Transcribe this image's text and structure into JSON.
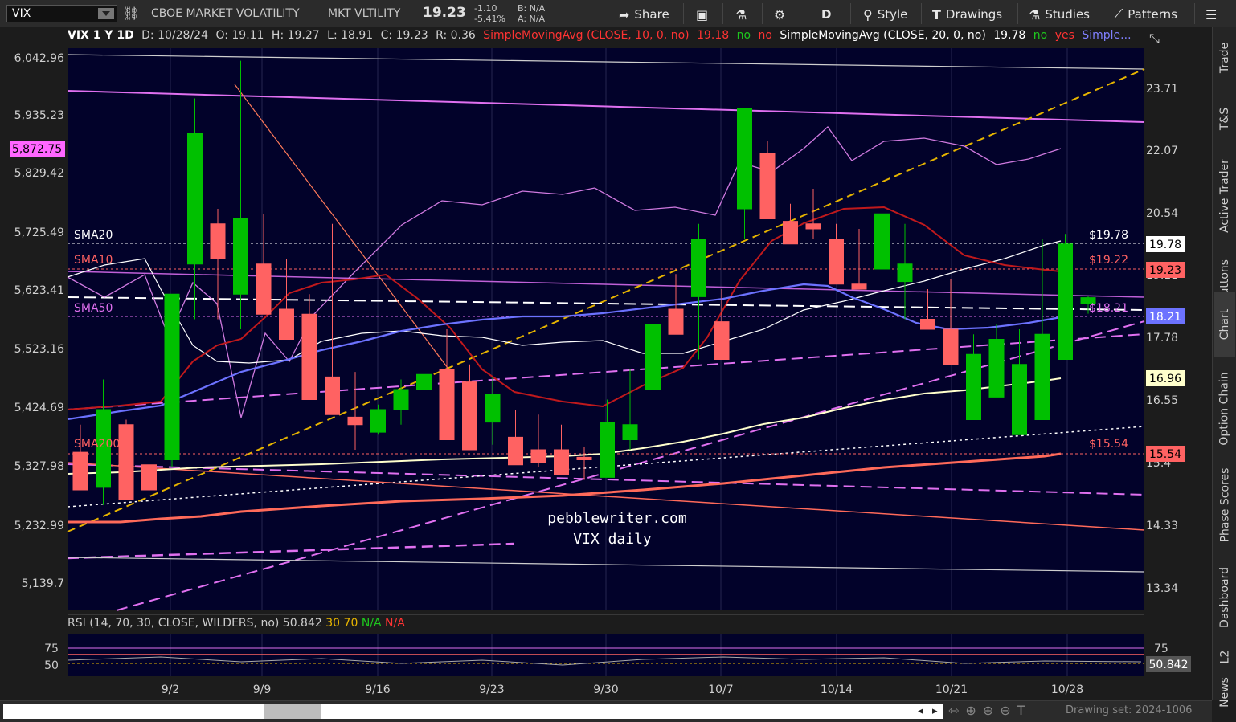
{
  "toolbar": {
    "symbol": "VIX",
    "description": "CBOE MARKET VOLATILITY",
    "short_name": "MKT VLTILITY",
    "last": "19.23",
    "change": "-1.10",
    "change_pct": "-5.41%",
    "bid": "B: N/A",
    "ask": "A: N/A",
    "share": "Share",
    "period": "D",
    "style": "Style",
    "drawings": "Drawings",
    "studies": "Studies",
    "patterns": "Patterns"
  },
  "legend": {
    "title": "VIX 1 Y 1D",
    "date": "D: 10/28/24",
    "open": "O: 19.11",
    "high": "H: 19.27",
    "low": "L: 18.91",
    "close": "C: 19.23",
    "range": "R: 0.36",
    "sma10_label": "SimpleMovingAvg (CLOSE, 10, 0, no)",
    "sma10_value": "19.18",
    "sma10_flag1": "no",
    "sma10_flag2": "no",
    "sma20_label": "SimpleMovingAvg (CLOSE, 20, 0, no)",
    "sma20_value": "19.78",
    "sma20_flag1": "no",
    "sma20_flag2": "yes",
    "more": "Simple..."
  },
  "colors": {
    "chart_bg": "#02022a",
    "up": "#00c000",
    "down": "#ff6262",
    "sma10": "#c0191c",
    "sma20": "#ffffff",
    "sma50": "#6c72ff",
    "sma200": "#ffffcc",
    "spx_line": "#d07ae0",
    "trend_yellow": "#e6b400",
    "magenta": "#e070f0"
  },
  "left_axis": [
    "6,042.96",
    "5,935.23",
    "5,829.42",
    "5,725.49",
    "5,623.41",
    "5,523.16",
    "5,424.69",
    "5,327.98",
    "5,232.99",
    "5,139.7"
  ],
  "left_marker": "5,872.75",
  "right_axis": [
    "23.71",
    "22.07",
    "20.54",
    "19.11",
    "17.78",
    "16.55",
    "15.4",
    "14.33",
    "13.34"
  ],
  "right_markers": {
    "sma20": "19.78",
    "last": "19.23",
    "sma50": "18.21",
    "sma200": "16.96",
    "support": "15.54"
  },
  "line_labels": {
    "sma20": "SMA20",
    "sma10": "SMA10",
    "sma50": "SMA50",
    "sma200": "SMA200",
    "sma20_val": "$19.78",
    "sma10_val": "$19.22",
    "sma50_val": "$18.21",
    "support_val": "$15.54"
  },
  "watermark": [
    "pebblewriter.com",
    "VIX daily"
  ],
  "x_dates": [
    "9/2",
    "9/9",
    "9/16",
    "9/23",
    "9/30",
    "10/7",
    "10/14",
    "10/21",
    "10/28"
  ],
  "chart_data": {
    "type": "candlestick",
    "symbol": "VIX",
    "timeframe": "1D",
    "yrange": [
      13.0,
      24.2
    ],
    "x": [
      "8/26",
      "8/27",
      "8/28",
      "8/29",
      "8/30",
      "9/3",
      "9/4",
      "9/5",
      "9/6",
      "9/9",
      "9/10",
      "9/11",
      "9/12",
      "9/13",
      "9/16",
      "9/17",
      "9/18",
      "9/19",
      "9/20",
      "9/23",
      "9/24",
      "9/25",
      "9/26",
      "9/27",
      "9/30",
      "10/1",
      "10/2",
      "10/3",
      "10/4",
      "10/7",
      "10/8",
      "10/9",
      "10/10",
      "10/11",
      "10/14",
      "10/15",
      "10/16",
      "10/17",
      "10/18",
      "10/21",
      "10/22",
      "10/23",
      "10/24",
      "10/25",
      "10/28"
    ],
    "open": [
      16.15,
      15.45,
      16.7,
      15.9,
      16.0,
      19.9,
      20.7,
      19.3,
      19.9,
      19.0,
      18.9,
      17.65,
      16.85,
      16.55,
      17.0,
      17.4,
      17.8,
      17.55,
      16.75,
      16.45,
      16.2,
      16.2,
      16.05,
      15.65,
      16.4,
      17.4,
      19.0,
      19.25,
      18.75,
      21.0,
      22.1,
      20.75,
      20.7,
      20.4,
      19.5,
      19.8,
      19.55,
      18.8,
      18.6,
      16.8,
      17.25,
      16.5,
      16.8,
      18.0,
      19.11
    ],
    "high": [
      16.7,
      17.6,
      16.8,
      16.05,
      19.2,
      23.2,
      21.0,
      23.95,
      20.9,
      20.0,
      19.3,
      20.7,
      17.75,
      17.1,
      17.6,
      17.85,
      18.6,
      17.9,
      17.65,
      17.0,
      16.9,
      16.7,
      16.25,
      17.2,
      17.8,
      19.8,
      19.7,
      20.7,
      19.4,
      23.0,
      22.35,
      21.1,
      21.4,
      20.7,
      20.6,
      20.4,
      20.7,
      19.4,
      19.6,
      18.5,
      18.7,
      18.6,
      20.4,
      20.5,
      19.27
    ],
    "low": [
      15.55,
      15.1,
      15.2,
      15.2,
      15.85,
      18.8,
      18.8,
      18.6,
      18.9,
      18.55,
      17.3,
      17.05,
      16.2,
      16.5,
      16.7,
      17.1,
      17.1,
      16.5,
      16.3,
      15.95,
      15.85,
      15.9,
      15.6,
      15.65,
      16.2,
      16.9,
      18.7,
      18.0,
      18.5,
      20.4,
      20.9,
      20.4,
      20.4,
      19.5,
      19.5,
      19.4,
      18.8,
      18.6,
      17.9,
      17.9,
      17.8,
      17.8,
      17.8,
      18.05,
      18.91
    ],
    "close": [
      15.4,
      17.0,
      15.2,
      15.4,
      19.3,
      22.5,
      20.0,
      20.8,
      18.9,
      18.4,
      17.2,
      16.9,
      16.7,
      17.0,
      17.4,
      17.7,
      16.4,
      16.2,
      17.3,
      15.9,
      15.95,
      15.7,
      16.0,
      16.75,
      16.7,
      18.7,
      18.5,
      20.4,
      18.0,
      23.0,
      20.8,
      20.3,
      20.6,
      19.5,
      19.4,
      20.9,
      19.9,
      18.6,
      17.9,
      18.1,
      18.4,
      17.9,
      18.5,
      20.3,
      19.23
    ]
  }
}
